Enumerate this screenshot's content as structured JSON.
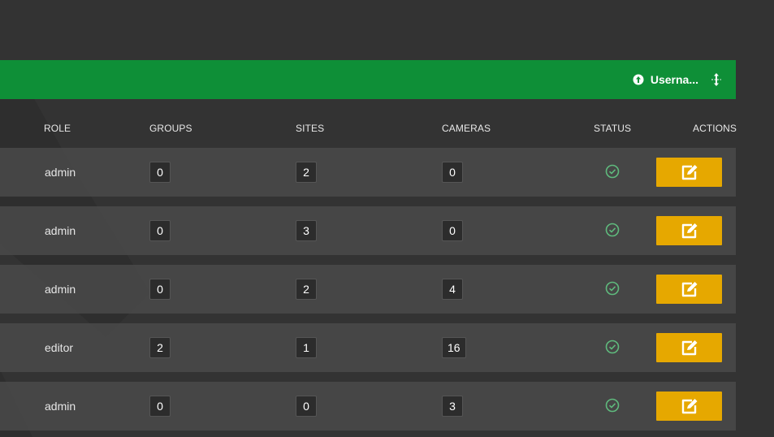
{
  "header": {
    "user_label": "Userna...",
    "user_icon": "circle-arrow-icon",
    "sort_icon": "move-vertical-icon"
  },
  "columns": {
    "role": "ROLE",
    "groups": "GROUPS",
    "sites": "SITES",
    "cameras": "CAMERAS",
    "status": "STATUS",
    "actions": "ACTIONS"
  },
  "rows": [
    {
      "role": "admin",
      "groups": "0",
      "sites": "2",
      "cameras": "0",
      "status": "active"
    },
    {
      "role": "admin",
      "groups": "0",
      "sites": "3",
      "cameras": "0",
      "status": "active"
    },
    {
      "role": "admin",
      "groups": "0",
      "sites": "2",
      "cameras": "4",
      "status": "active"
    },
    {
      "role": "editor",
      "groups": "2",
      "sites": "1",
      "cameras": "16",
      "status": "active"
    },
    {
      "role": "admin",
      "groups": "0",
      "sites": "0",
      "cameras": "3",
      "status": "active"
    }
  ],
  "colors": {
    "background": "#333333",
    "header_bar": "#0e8f37",
    "row_bg": "#484848",
    "edit_button": "#e6a800",
    "status_ok": "#5fba7d"
  }
}
